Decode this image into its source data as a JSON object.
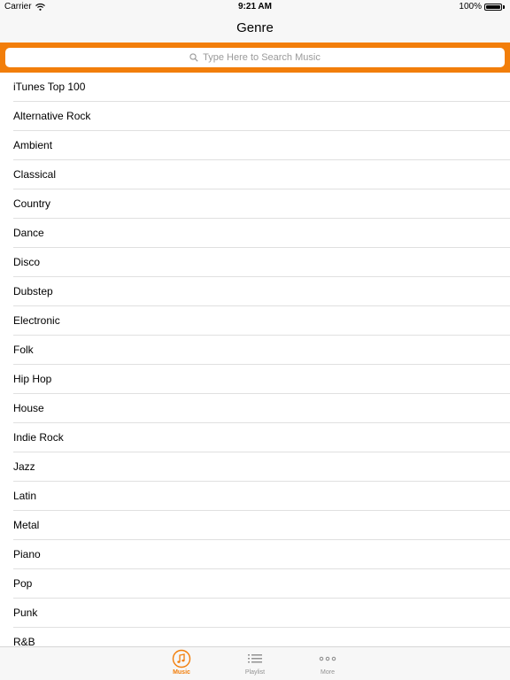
{
  "status_bar": {
    "carrier": "Carrier",
    "time": "9:21 AM",
    "battery": "100%"
  },
  "nav": {
    "title": "Genre"
  },
  "search": {
    "placeholder": "Type Here to Search Music"
  },
  "genres": [
    "iTunes Top 100",
    "Alternative Rock",
    "Ambient",
    "Classical",
    "Country",
    "Dance",
    "Disco",
    "Dubstep",
    "Electronic",
    "Folk",
    "Hip Hop",
    "House",
    "Indie Rock",
    "Jazz",
    "Latin",
    "Metal",
    "Piano",
    "Pop",
    "Punk",
    "R&B"
  ],
  "tabs": [
    {
      "label": "Music",
      "icon": "music-note-icon",
      "active": true
    },
    {
      "label": "Playlist",
      "icon": "list-icon",
      "active": false
    },
    {
      "label": "More",
      "icon": "more-dots-icon",
      "active": false
    }
  ],
  "colors": {
    "accent": "#f27e0a",
    "bar_background": "#f7f7f7",
    "separator": "#e0e0e0",
    "inactive_tab": "#929292"
  }
}
